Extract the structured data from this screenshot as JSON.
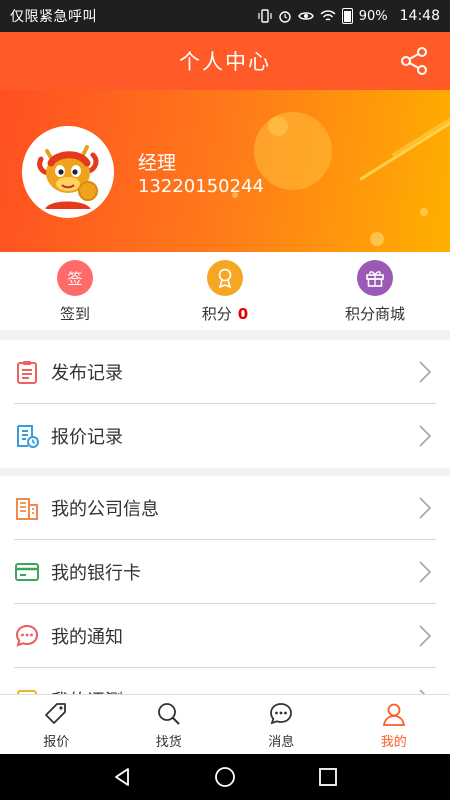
{
  "status_bar": {
    "carrier": "仅限紧急呼叫",
    "battery": "90%",
    "time": "14:48"
  },
  "header": {
    "title": "个人中心",
    "share_icon": "share-icon"
  },
  "profile": {
    "name": "经理",
    "phone": "13220150244",
    "avatar": "dragon-mascot-avatar"
  },
  "quick_actions": {
    "checkin": {
      "label": "签到",
      "icon_text": "签",
      "color": "#ff6b6b"
    },
    "points": {
      "label": "积分",
      "value": "0",
      "color": "#f5a623"
    },
    "mall": {
      "label": "积分商城",
      "color": "#9b59b6"
    }
  },
  "menu_group_1": [
    {
      "label": "发布记录",
      "icon": "clipboard-icon"
    },
    {
      "label": "报价记录",
      "icon": "document-clock-icon"
    }
  ],
  "menu_group_2": [
    {
      "label": "我的公司信息",
      "icon": "building-icon"
    },
    {
      "label": "我的银行卡",
      "icon": "card-icon"
    },
    {
      "label": "我的通知",
      "icon": "chat-icon"
    },
    {
      "label": "我的评测",
      "icon": "note-icon"
    }
  ],
  "tabbar": [
    {
      "label": "报价",
      "icon": "tag-icon"
    },
    {
      "label": "找货",
      "icon": "search-icon"
    },
    {
      "label": "消息",
      "icon": "message-icon"
    },
    {
      "label": "我的",
      "icon": "person-icon",
      "active": true
    }
  ],
  "colors": {
    "brand": "#ff5a28",
    "banner_end": "#ffb000"
  }
}
